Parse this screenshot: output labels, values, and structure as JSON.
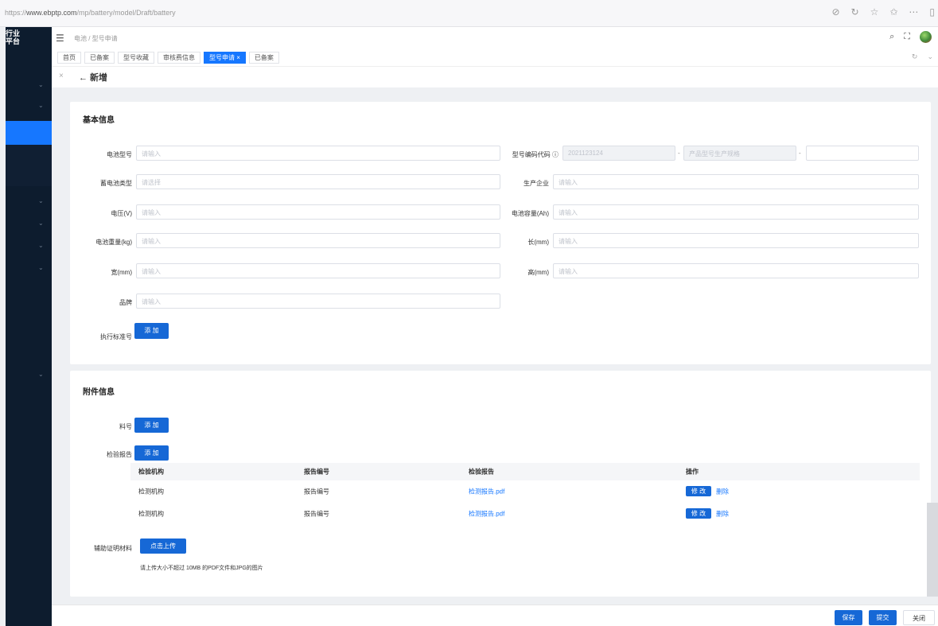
{
  "browser": {
    "url_prefix": "https://",
    "url_domain": "www.ebptp.com",
    "url_path": "/mp/battery/model/Draft/battery"
  },
  "sidebar": {
    "brand_line1": "行业",
    "brand_line2": "平台"
  },
  "header": {
    "breadcrumb": "电池 / 型号申请"
  },
  "tabs": [
    {
      "label": "首页",
      "active": false
    },
    {
      "label": "已备案",
      "active": false
    },
    {
      "label": "型号收藏",
      "active": false
    },
    {
      "label": "审核费信息",
      "active": false
    },
    {
      "label": "型号申请 ×",
      "active": true
    },
    {
      "label": "已备案",
      "active": false
    }
  ],
  "page": {
    "title": "← 新增",
    "close": "×"
  },
  "basic": {
    "title": "基本信息",
    "fields": {
      "battery_model": {
        "label": "电池型号",
        "placeholder": "请输入"
      },
      "code": {
        "label": "型号编码代码 ⓘ",
        "placeholder1": "2021123124",
        "placeholder2": "产品型号生产规格",
        "sep": "-"
      },
      "cell_type": {
        "label": "蓄电池类型",
        "placeholder": "请选择"
      },
      "manufacturer": {
        "label": "生产企业",
        "placeholder": "请输入"
      },
      "voltage": {
        "label": "电压(V)",
        "placeholder": "请输入"
      },
      "capacity": {
        "label": "电池容量(Ah)",
        "placeholder": "请输入"
      },
      "weight": {
        "label": "电池重量(kg)",
        "placeholder": "请输入"
      },
      "length": {
        "label": "长(mm)",
        "placeholder": "请输入"
      },
      "width": {
        "label": "宽(mm)",
        "placeholder": "请输入"
      },
      "height": {
        "label": "高(mm)",
        "placeholder": "请输入"
      },
      "remark": {
        "label": "品牌",
        "placeholder": "请输入"
      },
      "standard": {
        "label": "执行标准号",
        "button": "添 加"
      }
    }
  },
  "attach": {
    "title": "附件信息",
    "material": {
      "label": "料号",
      "button": "添 加"
    },
    "report": {
      "label": "检验报告",
      "button": "添 加"
    },
    "columns": [
      "检验机构",
      "报告编号",
      "检验报告",
      "操作"
    ],
    "rows": [
      {
        "org": "检测机构",
        "no": "报告编号",
        "file": "检测报告.pdf",
        "edit": "修 改",
        "del": "删除"
      },
      {
        "org": "检测机构",
        "no": "报告编号",
        "file": "检测报告.pdf",
        "edit": "修 改",
        "del": "删除"
      }
    ],
    "support": {
      "label": "辅助证明材料",
      "button": "点击上传"
    },
    "hint": "请上传大小不超过 10MB 的PDF文件和JPG的图片"
  },
  "footer": {
    "save": "保存",
    "submit": "提交",
    "cancel": "关闭"
  }
}
